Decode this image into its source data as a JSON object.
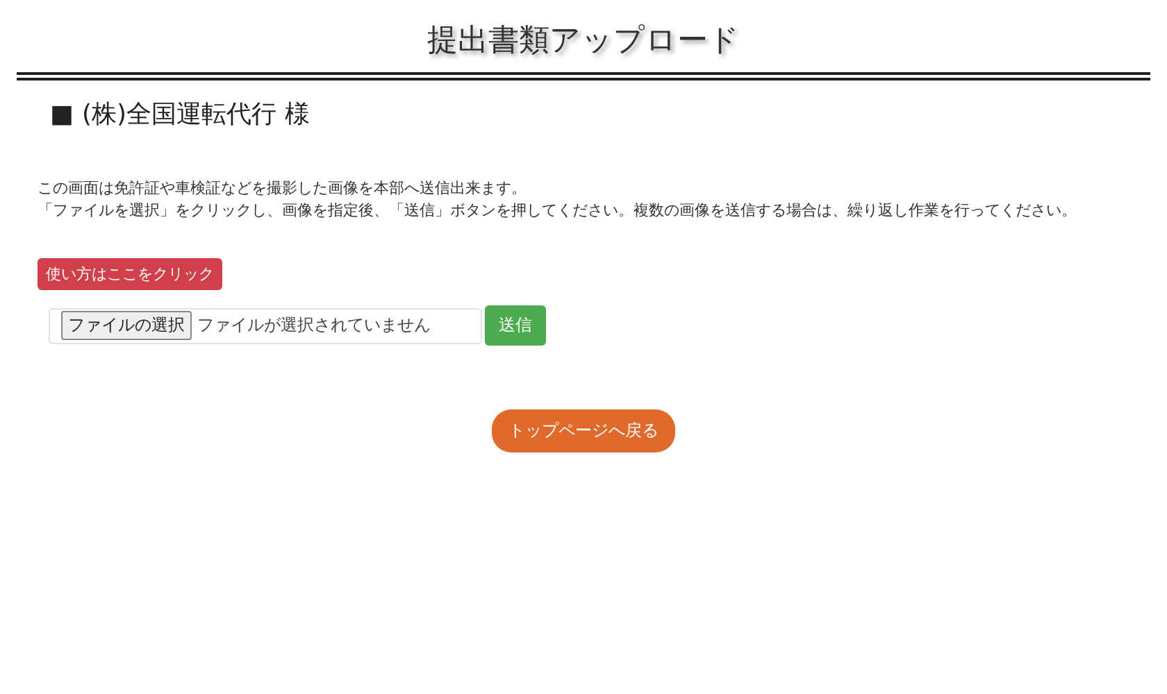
{
  "page_title": "提出書類アップロード",
  "heading": {
    "marker": "■",
    "text": "(株)全国運転代行 様"
  },
  "instructions": [
    "この画面は免許証や車検証などを撮影した画像を本部へ送信出来ます。",
    "「ファイルを選択」をクリックし、画像を指定後、「送信」ボタンを押してください。複数の画像を送信する場合は、繰り返し作業を行ってください。"
  ],
  "help_button": "使い方はここをクリック",
  "file_input": {
    "button": "ファイルの選択",
    "status": "ファイルが選択されていません"
  },
  "submit_button": "送信",
  "back_button": "トップページへ戻る"
}
